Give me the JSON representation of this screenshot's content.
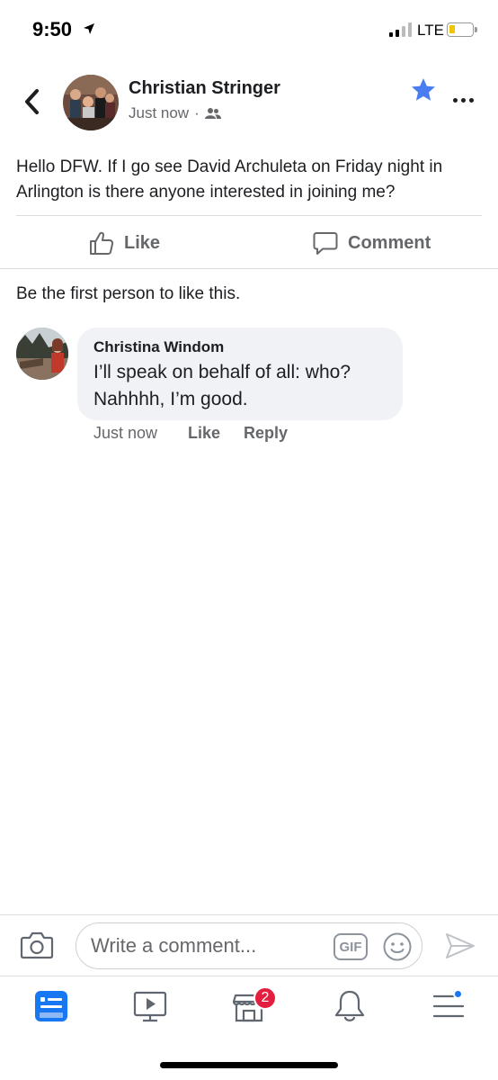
{
  "status_bar": {
    "time": "9:50",
    "network": "LTE",
    "signal_bars_filled": 2,
    "signal_bars_total": 4,
    "battery_level": 0.15,
    "battery_color": "#f2c500"
  },
  "post": {
    "author": "Christian Stringer",
    "timestamp": "Just now",
    "privacy_icon": "friends-icon",
    "star_color": "#1877f2",
    "text": "Hello DFW. If I go see David Archuleta on Friday night in Arlington is there anyone interested in joining me?",
    "actions": {
      "like": "Like",
      "comment": "Comment"
    },
    "likes_summary": "Be the first person to like this."
  },
  "comments": [
    {
      "author": "Christina Windom",
      "text": "I’ll speak on behalf of all: who? Nahhhh, I’m good.",
      "timestamp": "Just now",
      "like_label": "Like",
      "reply_label": "Reply"
    }
  ],
  "composer": {
    "placeholder": "Write a comment...",
    "gif_label": "GIF"
  },
  "tabbar": {
    "items": [
      {
        "name": "news-feed",
        "icon": "news-feed-icon",
        "active": true
      },
      {
        "name": "watch",
        "icon": "watch-icon",
        "active": false
      },
      {
        "name": "marketplace",
        "icon": "marketplace-icon",
        "active": false
      },
      {
        "name": "notifications",
        "icon": "bell-icon",
        "active": false
      },
      {
        "name": "menu",
        "icon": "menu-icon",
        "active": false
      }
    ],
    "marketplace_badge": "2",
    "accent_color": "#1877f2"
  }
}
